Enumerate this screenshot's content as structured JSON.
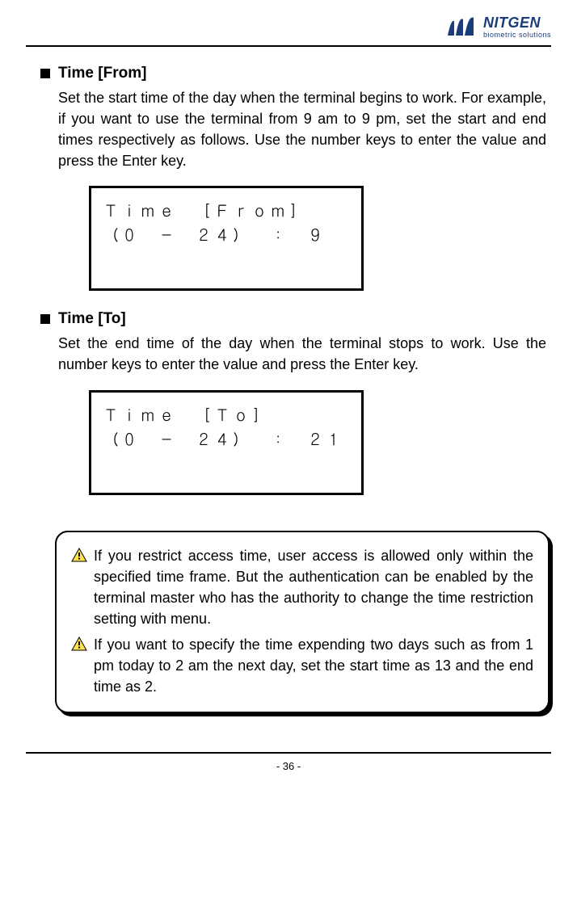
{
  "header": {
    "brand": "NITGEN",
    "subtitle": "biometric solutions"
  },
  "sections": [
    {
      "title": "Time [From]",
      "body": "Set the start time of the day when the terminal begins to work. For example, if you want to use the terminal from 9 am to 9 pm, set the start and end times respectively as follows. Use the number keys to enter the value and press the Enter key.",
      "terminal": "Ｔｉｍｅ　［Ｆｒｏｍ］\n（０　－　２４）　：　９"
    },
    {
      "title": "Time [To]",
      "body": "Set the end time of the day when the terminal stops to work. Use the number keys to enter the value and press the Enter key.",
      "terminal": "Ｔｉｍｅ　［Ｔｏ］\n（０　－　２４）　：　２１"
    }
  ],
  "notes": [
    "If you restrict access time, user access is allowed only within the specified time frame. But the authentication can be enabled by the terminal master who has the authority to change the time restriction setting with menu.",
    "If you want to specify the time expending two days such as from 1 pm today to 2 am the next day, set the start time as 13 and the end time as 2."
  ],
  "page_number": "- 36 -"
}
